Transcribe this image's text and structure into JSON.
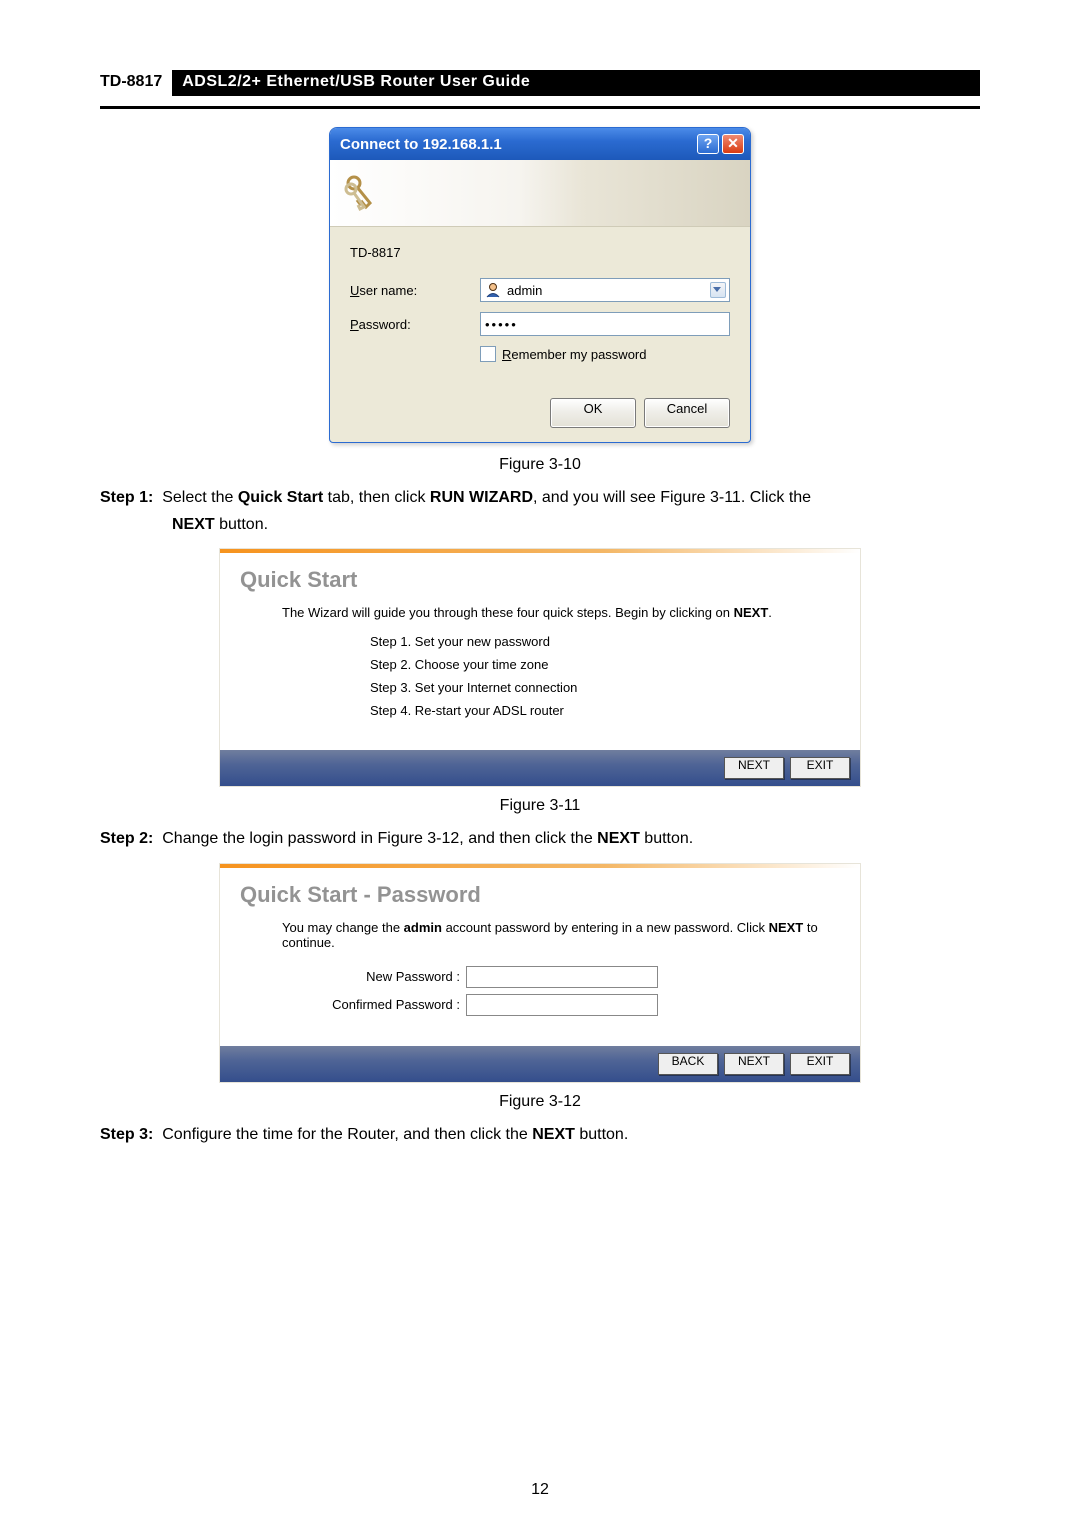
{
  "header": {
    "model": "TD-8817",
    "title": "ADSL2/2+  Ethernet/USB  Router  User  Guide"
  },
  "dialog": {
    "title": "Connect to 192.168.1.1",
    "model": "TD-8817",
    "username_label": "User name:",
    "username_value": "admin",
    "password_label": "Password:",
    "password_value": "•••••",
    "remember_label": "Remember my password",
    "ok": "OK",
    "cancel": "Cancel"
  },
  "captions": {
    "fig10": "Figure 3-10",
    "fig11": "Figure 3-11",
    "fig12": "Figure 3-12"
  },
  "steps": {
    "s1_label": "Step 1:",
    "s1a": "Select the ",
    "s1b": "Quick Start",
    "s1c": " tab, then click ",
    "s1d": "RUN WIZARD",
    "s1e": ", and you will see Figure 3-11. Click the ",
    "s1f": "NEXT",
    "s1g": " button.",
    "s2_label": "Step 2:",
    "s2a": "Change the login password in Figure 3-12, and then click the ",
    "s2b": "NEXT",
    "s2c": " button.",
    "s3_label": "Step 3:",
    "s3a": "Configure the time for the Router, and then click the ",
    "s3b": "NEXT",
    "s3c": " button."
  },
  "wizard1": {
    "title": "Quick Start",
    "lead_a": "The Wizard will guide you through these four quick steps. Begin by clicking on ",
    "lead_b": "NEXT",
    "lead_c": ".",
    "step1": "Step 1. Set your new password",
    "step2": "Step 2. Choose your time zone",
    "step3": "Step 3. Set your Internet connection",
    "step4": "Step 4. Re-start your ADSL router",
    "next": "NEXT",
    "exit": "EXIT"
  },
  "wizard2": {
    "title": "Quick Start - Password",
    "lead_a": "You may change the ",
    "lead_b": "admin",
    "lead_c": " account password by entering in a new password. Click ",
    "lead_d": "NEXT",
    "lead_e": " to continue.",
    "newpw": "New Password :",
    "confpw": "Confirmed Password :",
    "back": "BACK",
    "next": "NEXT",
    "exit": "EXIT"
  },
  "page_number": "12"
}
